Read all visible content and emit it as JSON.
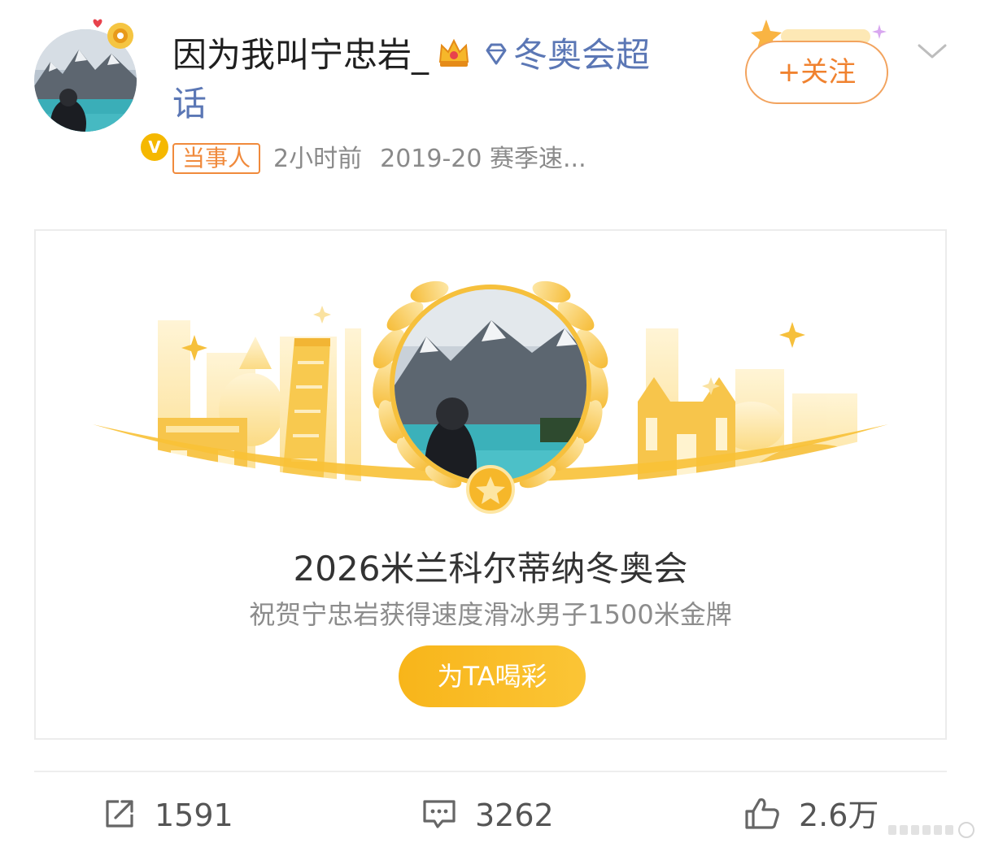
{
  "post": {
    "username": "因为我叫宁忠岩_",
    "topic_link": "冬奥会超话",
    "badge": "当事人",
    "time": "2小时前",
    "source": "2019-20 赛季速...",
    "follow_label": "+关注",
    "icons": {
      "crown": "crown-icon",
      "diamond": "diamond-icon",
      "verified": "verified-icon",
      "chevron": "chevron-down-icon",
      "verified_letter": "V"
    }
  },
  "card": {
    "title": "2026米兰科尔蒂纳冬奥会",
    "subtitle": "祝贺宁忠岩获得速度滑冰男子1500米金牌",
    "button_label": "为TA喝彩"
  },
  "footer": {
    "repost_count": "1591",
    "comment_count": "3262",
    "like_count": "2.6万"
  },
  "colors": {
    "accent_orange": "#f0822f",
    "gold": "#f8b51a",
    "link_blue": "#5b77b5"
  }
}
